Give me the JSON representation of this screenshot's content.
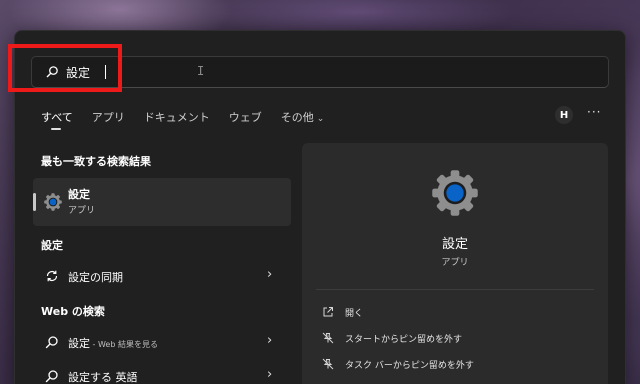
{
  "search": {
    "query": "設定",
    "cursor_glyph": "I"
  },
  "tabs": [
    {
      "label": "すべて",
      "active": true
    },
    {
      "label": "アプリ"
    },
    {
      "label": "ドキュメント"
    },
    {
      "label": "ウェブ"
    },
    {
      "label": "その他",
      "chevron": "⌄"
    }
  ],
  "header": {
    "avatar_initial": "H",
    "more_label": "···"
  },
  "best_match": {
    "section_title": "最も一致する検索結果",
    "name": "設定",
    "type": "アプリ",
    "icon": "settings-gear-icon"
  },
  "settings_section": {
    "title": "設定",
    "items": [
      {
        "label": "設定の同期",
        "icon": "sync-icon",
        "arrow": "›"
      }
    ]
  },
  "web_section": {
    "title": "Web の検索",
    "items": [
      {
        "label": "設定",
        "sub": " - Web 結果を見る",
        "icon": "search-icon",
        "arrow": "›"
      },
      {
        "label": "設定する 英語",
        "sub": "",
        "icon": "search-icon",
        "arrow": "›"
      }
    ]
  },
  "preview": {
    "name": "設定",
    "type": "アプリ",
    "actions": [
      {
        "label": "開く",
        "icon": "open-icon"
      },
      {
        "label": "スタートからピン留めを外す",
        "icon": "unpin-icon"
      },
      {
        "label": "タスク バーからピン留めを外す",
        "icon": "unpin-icon"
      }
    ]
  },
  "colors": {
    "panel": "#202020",
    "accent_blue": "#0a64c8",
    "highlight_red": "#ee1a1a"
  }
}
